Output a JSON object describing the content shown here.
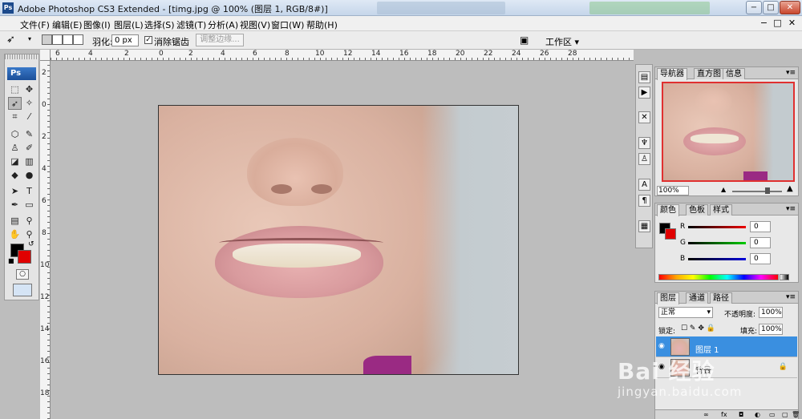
{
  "titlebar": {
    "logo": "Ps",
    "title": "Adobe Photoshop CS3 Extended - [timg.jpg @ 100% (图层 1, RGB/8#)]",
    "min": "−",
    "max": "□",
    "close": "✕"
  },
  "menu": {
    "items": [
      "文件(F)",
      "编辑(E)",
      "图像(I)",
      "图层(L)",
      "选择(S)",
      "滤镜(T)",
      "分析(A)",
      "视图(V)",
      "窗口(W)",
      "帮助(H)"
    ],
    "right_min": "−",
    "right_max": "□",
    "right_close": "✕"
  },
  "options": {
    "feather_label": "羽化:",
    "feather_value": "0 px",
    "antialias_label": "消除锯齿",
    "refine_edge": "调整边缘...",
    "workspace": "工作区 ▾"
  },
  "toolbox": {
    "badge": "Ps",
    "tools": [
      "marquee-icon",
      "move-icon",
      "lasso-icon",
      "magic-wand-icon",
      "crop-icon",
      "slice-icon",
      "heal-icon",
      "brush-icon",
      "stamp-icon",
      "history-brush-icon",
      "eraser-icon",
      "gradient-icon",
      "blur-icon",
      "dodge-icon",
      "path-select-icon",
      "type-icon",
      "pen-icon",
      "shape-icon",
      "notes-icon",
      "eyedropper-icon",
      "hand-icon",
      "zoom-icon"
    ]
  },
  "ruler": {
    "top": [
      "6",
      "4",
      "2",
      "0",
      "2",
      "4",
      "6",
      "8",
      "10",
      "12",
      "14",
      "16",
      "18",
      "20",
      "22",
      "24",
      "26",
      "28"
    ],
    "left": [
      "2",
      "0",
      "2",
      "4",
      "6",
      "8",
      "10",
      "12",
      "14",
      "16",
      "18"
    ]
  },
  "navigator": {
    "tabs": [
      "导航器",
      "直方图",
      "信息"
    ],
    "zoom": "100%"
  },
  "color": {
    "tabs": [
      "颜色",
      "色板",
      "样式"
    ],
    "r_label": "R",
    "g_label": "G",
    "b_label": "B",
    "r_value": "0",
    "g_value": "0",
    "b_value": "0",
    "fg": "#000000",
    "bg": "#e00000"
  },
  "layers": {
    "tabs": [
      "图层",
      "通道",
      "路径"
    ],
    "blend_mode": "正常",
    "opacity_label": "不透明度:",
    "opacity": "100%",
    "lock_label": "锁定:",
    "fill_label": "填充:",
    "fill": "100%",
    "rows": [
      {
        "name": "图层 1",
        "selected": true
      },
      {
        "name": "背景",
        "selected": false
      }
    ]
  },
  "watermark": {
    "line1": "Bai 经验",
    "line2": "jingyan.baidu.com"
  }
}
